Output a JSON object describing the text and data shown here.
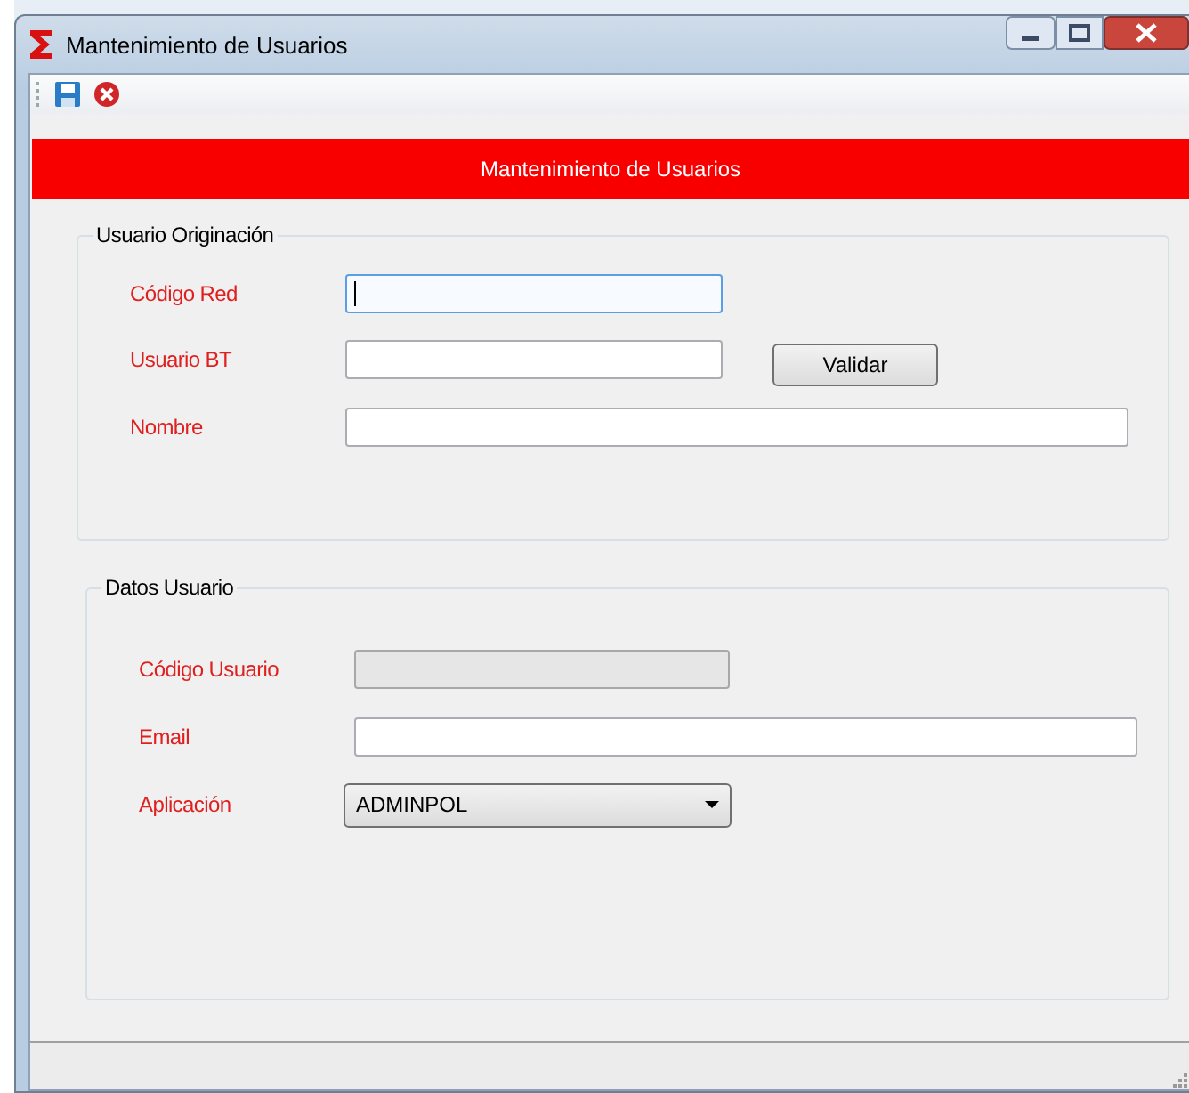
{
  "window": {
    "title": "Mantenimiento de Usuarios"
  },
  "banner": {
    "title": "Mantenimiento de Usuarios"
  },
  "groups": [
    {
      "title": "Usuario Originación",
      "fields": [
        {
          "kind": "text",
          "label": "Código Red",
          "focused": true,
          "disabled": false
        },
        {
          "kind": "text",
          "label": "Usuario BT",
          "focused": false,
          "disabled": false,
          "button": "Validar"
        },
        {
          "kind": "text",
          "label": "Nombre",
          "focused": false,
          "disabled": false
        }
      ]
    },
    {
      "title": "Datos Usuario",
      "fields": [
        {
          "kind": "text",
          "label": "Código Usuario",
          "focused": false,
          "disabled": true
        },
        {
          "kind": "text",
          "label": "Email",
          "focused": false,
          "disabled": false
        },
        {
          "kind": "select",
          "label": "Aplicación",
          "value": "ADMINPOL"
        }
      ]
    }
  ]
}
